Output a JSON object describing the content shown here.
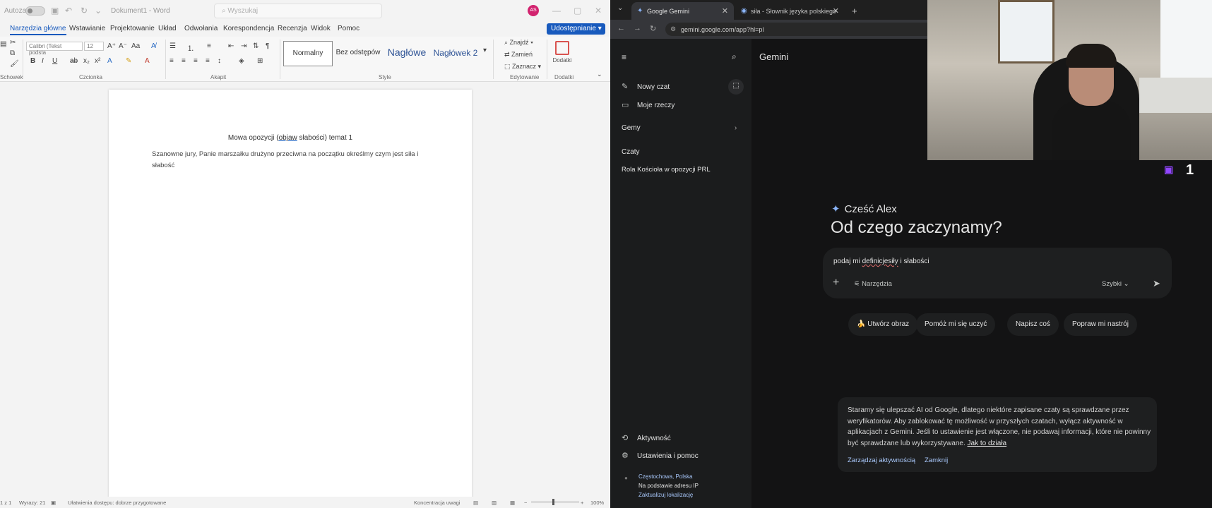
{
  "word": {
    "autosave_label": "Autozapis",
    "doc_name": "Dokument1 - Word",
    "search_placeholder": "Wyszukaj",
    "avatar_initials": "AS",
    "menu": [
      "Narzędzia główne",
      "Wstawianie",
      "Projektowanie",
      "Układ",
      "Odwołania",
      "Korespondencja",
      "Recenzja",
      "Widok",
      "Pomoc"
    ],
    "share_label": "Udostępnianie",
    "font_name": "Calibri (Tekst podsta",
    "font_size": "12",
    "groups": [
      "Schowek",
      "Czcionka",
      "Akapit",
      "Style",
      "Edytowanie",
      "Dodatki"
    ],
    "styles": [
      "Normalny",
      "Bez odstępów",
      "Nagłówe",
      "Nagłówek 2"
    ],
    "editing": [
      "Znajdź",
      "Zamień",
      "Zaznacz"
    ],
    "addins_label": "Dodatki",
    "doc_title_pre": "Mowa opozycji (",
    "doc_title_u": "objaw",
    "doc_title_post": " słabości) temat 1",
    "doc_body": "Szanowne jury, Panie marszałku drużyno przeciwna na początku określmy czym jest siła i słabość",
    "status": {
      "page": "1 z 1",
      "words": "Wyrazy: 21",
      "accessibility": "Ułatwienia dostępu: dobrze przygotowane",
      "focus": "Koncentracja uwagi",
      "zoom": "100%"
    }
  },
  "browser": {
    "tabs": [
      "Google Gemini",
      "siła - Słownik języka polskiego"
    ],
    "url": "gemini.google.com/app?hl=pl"
  },
  "gemini": {
    "brand": "Gemini",
    "sidebar": {
      "new_chat": "Nowy czat",
      "my_stuff": "Moje rzeczy",
      "gems": "Gemy",
      "chats_header": "Czaty",
      "chats": [
        "Rola Kościoła w opozycji PRL"
      ],
      "activity": "Aktywność",
      "settings": "Ustawienia i pomoc",
      "location_city": "Częstochowa, Polska",
      "location_basis": "Na podstawie adresu IP",
      "location_update": "Zaktualizuj lokalizację"
    },
    "greeting": "Cześć Alex",
    "headline": "Od czego zaczynamy?",
    "prompt_pre": "podaj mi ",
    "prompt_misspelled": "definicjesiły",
    "prompt_post": " i słabości",
    "tools_label": "Narzędzia",
    "mode_label": "Szybki",
    "chips": [
      "🍌 Utwórz obraz",
      "Pomóż mi się uczyć",
      "Napisz coś",
      "Popraw mi nastrój"
    ],
    "notice_text": "Staramy się ulepszać AI od Google, dlatego niektóre zapisane czaty są sprawdzane przez weryfikatorów. Aby zablokować tę możliwość w przyszłych czatach, wyłącz aktywność w aplikacjach z Gemini. Jeśli to ustawienie jest włączone, nie podawaj informacji, które nie powinny być sprawdzane lub wykorzystywane.",
    "notice_link": "Jak to działa",
    "manage_activity": "Zarządzaj aktywnością",
    "close": "Zamknij"
  },
  "overlay": {
    "viewer_count": "1"
  }
}
